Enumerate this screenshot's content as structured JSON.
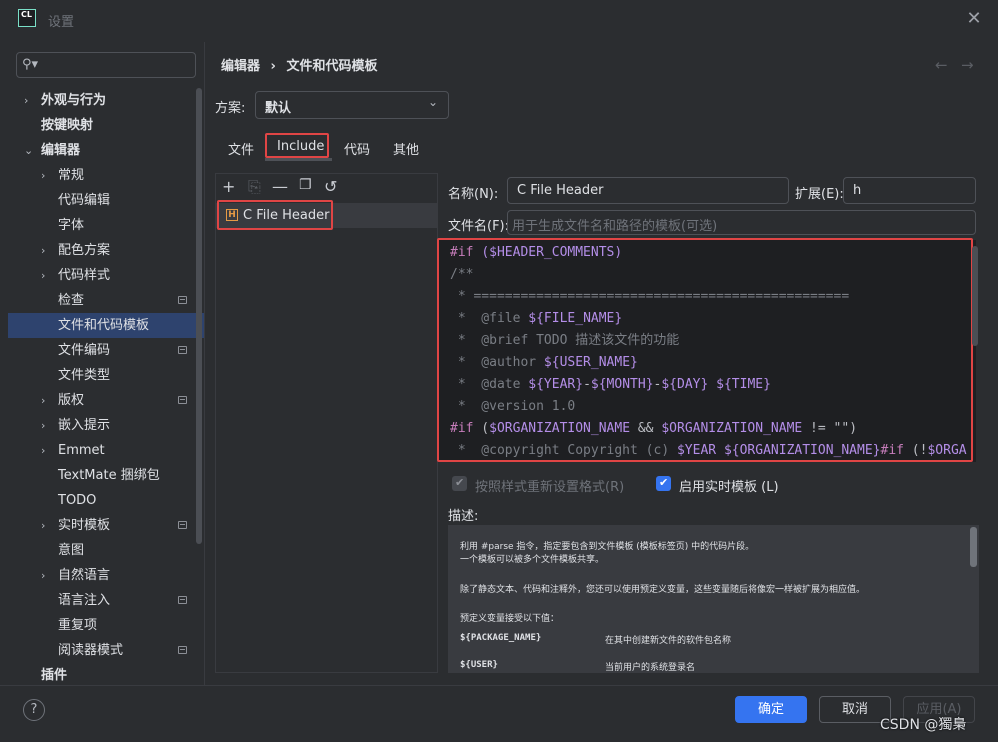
{
  "window": {
    "app_icon": "CL",
    "title": "设置"
  },
  "search": {
    "placeholder": ""
  },
  "sidebar": {
    "items": [
      {
        "label": "外观与行为",
        "chevron": "›"
      },
      {
        "label": "按键映射"
      },
      {
        "label": "编辑器",
        "chevron": "⌄"
      },
      {
        "label": "常规",
        "chevron": "›"
      },
      {
        "label": "代码编辑"
      },
      {
        "label": "字体"
      },
      {
        "label": "配色方案",
        "chevron": "›"
      },
      {
        "label": "代码样式",
        "chevron": "›"
      },
      {
        "label": "检查"
      },
      {
        "label": "文件和代码模板"
      },
      {
        "label": "文件编码"
      },
      {
        "label": "文件类型"
      },
      {
        "label": "版权",
        "chevron": "›"
      },
      {
        "label": "嵌入提示",
        "chevron": "›"
      },
      {
        "label": "Emmet",
        "chevron": "›"
      },
      {
        "label": "TextMate 捆绑包"
      },
      {
        "label": "TODO"
      },
      {
        "label": "实时模板",
        "chevron": "›"
      },
      {
        "label": "意图"
      },
      {
        "label": "自然语言",
        "chevron": "›"
      },
      {
        "label": "语言注入"
      },
      {
        "label": "重复项"
      },
      {
        "label": "阅读器模式"
      },
      {
        "label": "插件"
      }
    ]
  },
  "breadcrumb": {
    "parent": "编辑器",
    "sep": "›",
    "current": "文件和代码模板"
  },
  "nav": {
    "back": "←",
    "forward": "→"
  },
  "scheme": {
    "label": "方案:",
    "value": "默认",
    "chevron": "⌄"
  },
  "tabs": {
    "files": "文件",
    "include": "Include",
    "code": "代码",
    "other": "其他"
  },
  "toolbar": {
    "add": "+",
    "copy": "⎘",
    "remove": "—",
    "duplicate": "❐",
    "reset": "↺"
  },
  "templates": {
    "items": [
      {
        "icon": "H",
        "label": "C File Header"
      }
    ]
  },
  "form": {
    "name_label": "名称(N):",
    "name_value": "C File Header",
    "ext_label": "扩展(E):",
    "ext_value": "h",
    "filename_label": "文件名(F):",
    "filename_placeholder": "用于生成文件名和路径的模板(可选)"
  },
  "editor": {
    "l1_kw": "#if",
    "l1_var": "($HEADER_COMMENTS)",
    "l2": "/**",
    "l3": " * ================================================",
    "l4_a": " *  @file ",
    "l4_var": "${FILE_NAME}",
    "l5": " *  @brief TODO 描述该文件的功能",
    "l6_a": " *  @author ",
    "l6_var": "${USER_NAME}",
    "l7_a": " *  @date ",
    "l7_var1": "${YEAR}",
    "l7_d1": "-",
    "l7_var2": "${MONTH}",
    "l7_d2": "-",
    "l7_var3": "${DAY}",
    "l7_sp": " ",
    "l7_var4": "${TIME}",
    "l8": " *  @version 1.0",
    "l9_kw": "#if",
    "l9_a": " (",
    "l9_var1": "$ORGANIZATION_NAME",
    "l9_b": " && ",
    "l9_var2": "$ORGANIZATION_NAME",
    "l9_c": " != \"\")",
    "l10_a": " *  @copyright Copyright (c) ",
    "l10_var1": "$YEAR",
    "l10_sp": " ",
    "l10_var2": "${ORGANIZATION_NAME}",
    "l10_kw": "#if",
    "l10_b": " (!",
    "l10_var3": "$ORGA"
  },
  "options": {
    "reformat_label": "按照样式重新设置格式(R)",
    "reformat_checked": true,
    "live_label": "启用实时模板 (L)",
    "live_checked": true
  },
  "description": {
    "label": "描述:",
    "line1": "利用 #parse 指令，指定要包含到文件模板 (模板标签页) 中的代码片段。",
    "line2": "一个模板可以被多个文件模板共享。",
    "line3": "除了静态文本、代码和注释外，您还可以使用预定义变量，这些变量随后将像宏一样被扩展为相应值。",
    "line4": "预定义变量接受以下值：",
    "var1_name": "${PACKAGE_NAME}",
    "var1_desc": "在其中创建新文件的软件包名称",
    "var2_name": "${USER}",
    "var2_desc": "当前用户的系统登录名"
  },
  "footer": {
    "help": "?",
    "ok": "确定",
    "cancel": "取消",
    "apply": "应用(A)"
  },
  "watermark": "CSDN @獨梟",
  "colors": {
    "accent": "#3574f0",
    "highlight": "#e04545",
    "selection": "#2e436e"
  }
}
